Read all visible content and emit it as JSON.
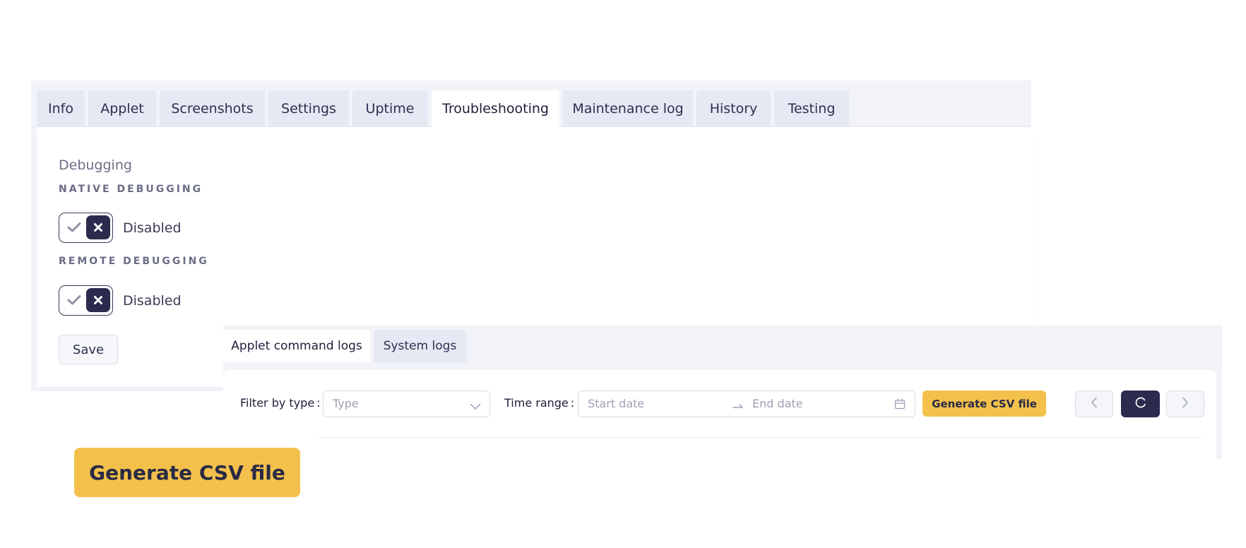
{
  "main_tabs": [
    {
      "label": "Info"
    },
    {
      "label": "Applet"
    },
    {
      "label": "Screenshots"
    },
    {
      "label": "Settings"
    },
    {
      "label": "Uptime"
    },
    {
      "label": "Troubleshooting",
      "active": true
    },
    {
      "label": "Maintenance log"
    },
    {
      "label": "History"
    },
    {
      "label": "Testing"
    }
  ],
  "debugging": {
    "section_title": "Debugging",
    "native": {
      "heading": "NATIVE DEBUGGING",
      "status": "Disabled",
      "enabled": false
    },
    "remote": {
      "heading": "REMOTE DEBUGGING",
      "status": "Disabled",
      "enabled": false
    },
    "save_label": "Save"
  },
  "logs": {
    "tabs": [
      {
        "label": "Applet command logs",
        "active": true
      },
      {
        "label": "System logs"
      }
    ],
    "filter_label": "Filter by type",
    "filter_placeholder": "Type",
    "time_range_label": "Time range",
    "start_placeholder": "Start date",
    "end_placeholder": "End date",
    "colon": ":",
    "generate_csv_label": "Generate CSV file"
  },
  "callout": {
    "label": "Generate CSV file"
  },
  "colors": {
    "accent": "#f3c14b",
    "dark": "#2b2b4e",
    "panel_bg": "#f1f3f9",
    "tab_bg": "#e6e8f3"
  },
  "icons": {
    "check": "check-icon",
    "close": "close-icon",
    "chevron_down": "chevron-down-icon",
    "arrow_right": "arrow-right-icon",
    "calendar": "calendar-icon",
    "prev": "chevron-left-icon",
    "refresh": "refresh-icon",
    "next": "chevron-right-icon"
  }
}
